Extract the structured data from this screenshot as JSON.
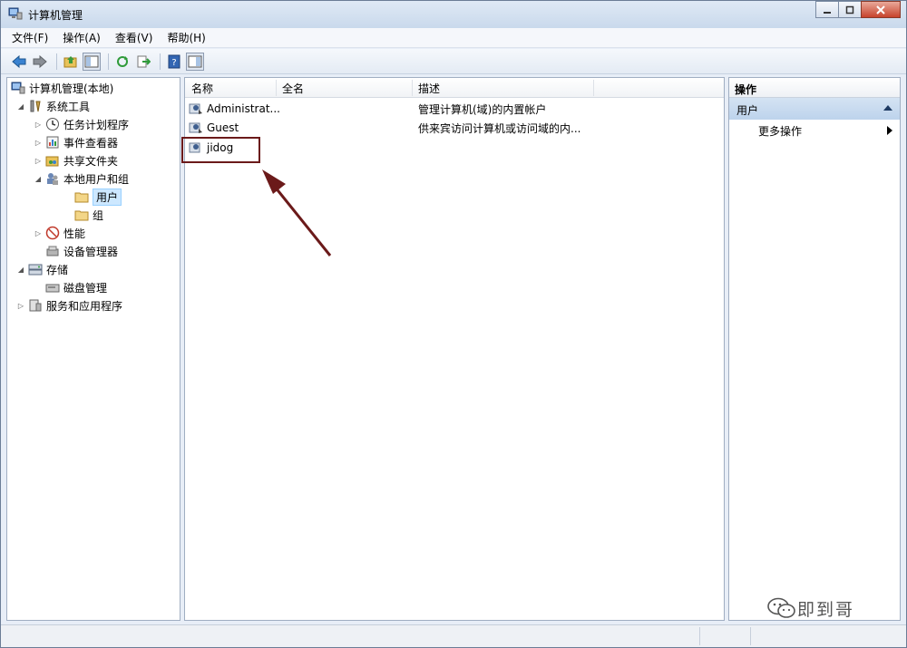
{
  "window": {
    "title": "计算机管理"
  },
  "menu": [
    "文件(F)",
    "操作(A)",
    "查看(V)",
    "帮助(H)"
  ],
  "toolbar": [
    {
      "icon": "back-arrow-icon"
    },
    {
      "icon": "forward-arrow-icon"
    },
    {
      "icon": "up-folder-icon"
    },
    {
      "icon": "show-hide-tree-icon"
    },
    {
      "icon": "refresh-icon"
    },
    {
      "icon": "export-list-icon"
    },
    {
      "icon": "help-icon"
    },
    {
      "icon": "show-hide-action-pane-icon"
    }
  ],
  "tree": {
    "root": "计算机管理(本地)",
    "items": [
      {
        "label": "系统工具",
        "expander": "◢"
      },
      {
        "label": "任务计划程序",
        "expander": "▷"
      },
      {
        "label": "事件查看器",
        "expander": "▷"
      },
      {
        "label": "共享文件夹",
        "expander": "▷"
      },
      {
        "label": "本地用户和组",
        "expander": "◢"
      },
      {
        "label": "用户",
        "expander": ""
      },
      {
        "label": "组",
        "expander": ""
      },
      {
        "label": "性能",
        "expander": "▷"
      },
      {
        "label": "设备管理器",
        "expander": ""
      },
      {
        "label": "存储",
        "expander": "◢"
      },
      {
        "label": "磁盘管理",
        "expander": ""
      },
      {
        "label": "服务和应用程序",
        "expander": "▷"
      }
    ]
  },
  "list": {
    "columns": [
      "名称",
      "全名",
      "描述"
    ],
    "rows": [
      {
        "name": "Administrat...",
        "fullname": "",
        "description": "管理计算机(域)的内置帐户"
      },
      {
        "name": "Guest",
        "fullname": "",
        "description": "供来宾访问计算机或访问域的内..."
      },
      {
        "name": "jidog",
        "fullname": "",
        "description": ""
      }
    ]
  },
  "actions": {
    "header": "操作",
    "section": "用户",
    "item": "更多操作"
  },
  "watermark": "即到哥",
  "colors": {
    "annotation": "#6b1a1a",
    "selection": "#cde8ff",
    "action_section": "#c8dbf0"
  }
}
